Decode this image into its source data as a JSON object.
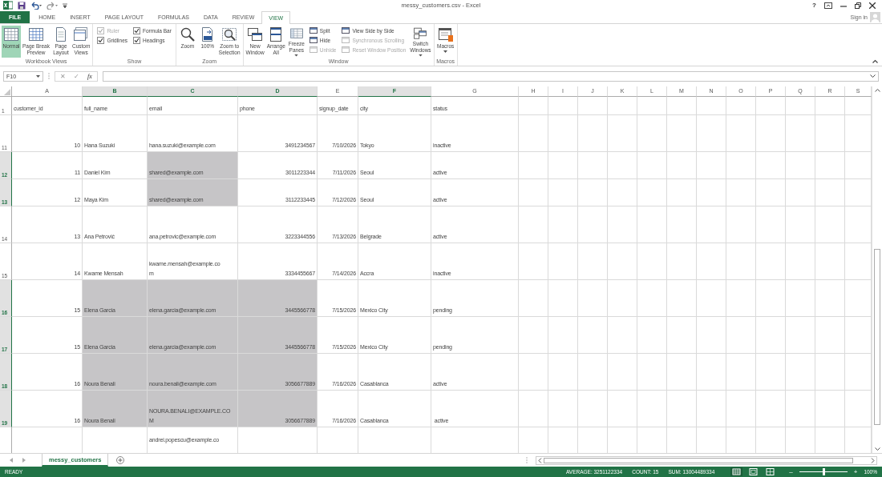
{
  "window": {
    "title": "messy_customers.csv - Excel",
    "help": "?",
    "sign_in": "Sign in"
  },
  "tabs": [
    {
      "label": "FILE",
      "kind": "file",
      "selected": false
    },
    {
      "label": "HOME",
      "kind": "tab",
      "selected": false
    },
    {
      "label": "INSERT",
      "kind": "tab",
      "selected": false
    },
    {
      "label": "PAGE LAYOUT",
      "kind": "tab",
      "selected": false
    },
    {
      "label": "FORMULAS",
      "kind": "tab",
      "selected": false
    },
    {
      "label": "DATA",
      "kind": "tab",
      "selected": false
    },
    {
      "label": "REVIEW",
      "kind": "tab",
      "selected": false
    },
    {
      "label": "VIEW",
      "kind": "tab",
      "selected": true
    }
  ],
  "ribbon": [
    {
      "label": "Workbook Views",
      "items": [
        {
          "kind": "large",
          "label": "Normal",
          "selected": true,
          "has_menu": false
        },
        {
          "kind": "large",
          "label": "Page Break\nPreview",
          "selected": false,
          "has_menu": false
        },
        {
          "kind": "large",
          "label": "Page\nLayout",
          "selected": false,
          "has_menu": false
        },
        {
          "kind": "large",
          "label": "Custom\nViews",
          "selected": false,
          "has_menu": false
        }
      ]
    },
    {
      "label": "Show",
      "items": [
        {
          "kind": "stack",
          "items": [
            {
              "kind": "checkbox",
              "label": "Ruler",
              "checked": true,
              "disabled": true
            },
            {
              "kind": "checkbox",
              "label": "Gridlines",
              "checked": true,
              "disabled": false
            }
          ]
        },
        {
          "kind": "stack",
          "items": [
            {
              "kind": "checkbox",
              "label": "Formula Bar",
              "checked": true,
              "disabled": false
            },
            {
              "kind": "checkbox",
              "label": "Headings",
              "checked": true,
              "disabled": false
            }
          ]
        }
      ]
    },
    {
      "label": "Zoom",
      "items": [
        {
          "kind": "large",
          "label": "Zoom",
          "selected": false,
          "has_menu": false
        },
        {
          "kind": "large",
          "label": "100%",
          "selected": false,
          "has_menu": false
        },
        {
          "kind": "large",
          "label": "Zoom to\nSelection",
          "selected": false,
          "has_menu": false
        }
      ]
    },
    {
      "label": "Window",
      "items": [
        {
          "kind": "large",
          "label": "New\nWindow",
          "selected": false,
          "has_menu": false
        },
        {
          "kind": "large",
          "label": "Arrange\nAll",
          "selected": false,
          "has_menu": false
        },
        {
          "kind": "large",
          "label": "Freeze\nPanes",
          "selected": false,
          "has_menu": true
        },
        {
          "kind": "stack",
          "items": [
            {
              "kind": "button",
              "label": "Split",
              "disabled": false
            },
            {
              "kind": "button",
              "label": "Hide",
              "disabled": false
            },
            {
              "kind": "button",
              "label": "Unhide",
              "disabled": true
            }
          ]
        },
        {
          "kind": "stack",
          "items": [
            {
              "kind": "button",
              "label": "View Side by Side",
              "disabled": false
            },
            {
              "kind": "button",
              "label": "Synchronous Scrolling",
              "disabled": true
            },
            {
              "kind": "button",
              "label": "Reset Window Position",
              "disabled": true
            }
          ]
        },
        {
          "kind": "large",
          "label": "Switch\nWindows",
          "selected": false,
          "has_menu": true
        }
      ]
    },
    {
      "label": "Macros",
      "items": [
        {
          "kind": "large",
          "label": "Macros",
          "selected": false,
          "has_menu": true
        }
      ]
    }
  ],
  "formula_bar": {
    "name_box": "F10",
    "cancel": "✕",
    "enter": "✓",
    "function_label": "fx"
  },
  "columns": [
    {
      "letter": "A",
      "selected": false
    },
    {
      "letter": "B",
      "selected": true
    },
    {
      "letter": "C",
      "selected": true
    },
    {
      "letter": "D",
      "selected": true
    },
    {
      "letter": "E",
      "selected": false
    },
    {
      "letter": "F",
      "selected": true
    },
    {
      "letter": "G",
      "selected": false
    },
    {
      "letter": "H",
      "selected": false
    },
    {
      "letter": "I",
      "selected": false
    },
    {
      "letter": "J",
      "selected": false
    },
    {
      "letter": "K",
      "selected": false
    },
    {
      "letter": "L",
      "selected": false
    },
    {
      "letter": "M",
      "selected": false
    },
    {
      "letter": "N",
      "selected": false
    },
    {
      "letter": "O",
      "selected": false
    },
    {
      "letter": "P",
      "selected": false
    },
    {
      "letter": "Q",
      "selected": false
    },
    {
      "letter": "R",
      "selected": false
    },
    {
      "letter": "S",
      "selected": false
    }
  ],
  "rows": [
    {
      "number": "1",
      "selected": false,
      "cells": [
        {
          "text": "customer_id",
          "kind": "text",
          "selected": false
        },
        {
          "text": "full_name",
          "kind": "text",
          "selected": false
        },
        {
          "text": "email",
          "kind": "text",
          "selected": false
        },
        {
          "text": "phone",
          "kind": "text",
          "selected": false
        },
        {
          "text": "signup_date",
          "kind": "text",
          "selected": false
        },
        {
          "text": "city",
          "kind": "text",
          "selected": false
        },
        {
          "text": "status",
          "kind": "text",
          "selected": false
        }
      ]
    },
    {
      "number": "11",
      "selected": false,
      "cells": [
        {
          "text": "10",
          "kind": "number",
          "selected": false
        },
        {
          "text": "Hana Suzuki",
          "kind": "text",
          "selected": false
        },
        {
          "text": "hana.suzuki@example.com",
          "kind": "text",
          "selected": false
        },
        {
          "text": "3491234567",
          "kind": "number",
          "selected": false
        },
        {
          "text": "7/10/2026",
          "kind": "number",
          "selected": false
        },
        {
          "text": "Tokyo",
          "kind": "text",
          "selected": false
        },
        {
          "text": "inactive",
          "kind": "text",
          "selected": false
        }
      ]
    },
    {
      "number": "12",
      "selected": true,
      "cells": [
        {
          "text": "11",
          "kind": "number",
          "selected": false
        },
        {
          "text": "Daniel Kim",
          "kind": "text",
          "selected": false
        },
        {
          "text": "shared@example.com",
          "kind": "text",
          "selected": true
        },
        {
          "text": "3011223344",
          "kind": "number",
          "selected": false
        },
        {
          "text": "7/11/2026",
          "kind": "number",
          "selected": false
        },
        {
          "text": "Seoul",
          "kind": "text",
          "selected": false
        },
        {
          "text": "active",
          "kind": "text",
          "selected": false
        }
      ]
    },
    {
      "number": "13",
      "selected": true,
      "cells": [
        {
          "text": "12",
          "kind": "number",
          "selected": false
        },
        {
          "text": "Maya Kim",
          "kind": "text",
          "selected": false
        },
        {
          "text": "shared@example.com",
          "kind": "text",
          "selected": true
        },
        {
          "text": "3112233445",
          "kind": "number",
          "selected": false
        },
        {
          "text": "7/12/2026",
          "kind": "number",
          "selected": false
        },
        {
          "text": "Seoul",
          "kind": "text",
          "selected": false
        },
        {
          "text": "active",
          "kind": "text",
          "selected": false
        }
      ]
    },
    {
      "number": "14",
      "selected": false,
      "cells": [
        {
          "text": "13",
          "kind": "number",
          "selected": false
        },
        {
          "text": "Ana Petrović",
          "kind": "text",
          "selected": false
        },
        {
          "text": "ana.petrovic@example.com",
          "kind": "text",
          "selected": false
        },
        {
          "text": "3223344556",
          "kind": "number",
          "selected": false
        },
        {
          "text": "7/13/2026",
          "kind": "number",
          "selected": false
        },
        {
          "text": "Belgrade",
          "kind": "text",
          "selected": false
        },
        {
          "text": "active",
          "kind": "text",
          "selected": false
        }
      ]
    },
    {
      "number": "15",
      "selected": false,
      "cells": [
        {
          "text": "14",
          "kind": "number",
          "selected": false
        },
        {
          "text": "Kwame Mensah",
          "kind": "text",
          "selected": false
        },
        {
          "text": "kwame.mensah@example.co\nm",
          "kind": "text",
          "selected": false
        },
        {
          "text": "3334455667",
          "kind": "number",
          "selected": false
        },
        {
          "text": "7/14/2026",
          "kind": "number",
          "selected": false
        },
        {
          "text": "Accra",
          "kind": "text",
          "selected": false
        },
        {
          "text": "inactive",
          "kind": "text",
          "selected": false
        }
      ]
    },
    {
      "number": "16",
      "selected": true,
      "cells": [
        {
          "text": "15",
          "kind": "number",
          "selected": false
        },
        {
          "text": "Elena Garcia",
          "kind": "text",
          "selected": true
        },
        {
          "text": "elena.garcia@example.com",
          "kind": "text",
          "selected": true
        },
        {
          "text": "3445566778",
          "kind": "number",
          "selected": true
        },
        {
          "text": "7/15/2026",
          "kind": "number",
          "selected": false
        },
        {
          "text": "Mexico City",
          "kind": "text",
          "selected": false
        },
        {
          "text": "pending",
          "kind": "text",
          "selected": false
        }
      ]
    },
    {
      "number": "17",
      "selected": true,
      "cells": [
        {
          "text": "15",
          "kind": "number",
          "selected": false
        },
        {
          "text": "Elena Garcia",
          "kind": "text",
          "selected": true
        },
        {
          "text": "elena.garcia@example.com",
          "kind": "text",
          "selected": true
        },
        {
          "text": "3445566778",
          "kind": "number",
          "selected": true
        },
        {
          "text": "7/15/2026",
          "kind": "number",
          "selected": false
        },
        {
          "text": "Mexico City",
          "kind": "text",
          "selected": false
        },
        {
          "text": "pending",
          "kind": "text",
          "selected": false
        }
      ]
    },
    {
      "number": "18",
      "selected": true,
      "cells": [
        {
          "text": "16",
          "kind": "number",
          "selected": false
        },
        {
          "text": "Noura Benali",
          "kind": "text",
          "selected": true
        },
        {
          "text": "noura.benali@example.com",
          "kind": "text",
          "selected": true
        },
        {
          "text": "3056677889",
          "kind": "number",
          "selected": true
        },
        {
          "text": "7/16/2026",
          "kind": "number",
          "selected": false
        },
        {
          "text": "Casablanca",
          "kind": "text",
          "selected": false
        },
        {
          "text": "active",
          "kind": "text",
          "selected": false
        }
      ]
    },
    {
      "number": "19",
      "selected": true,
      "cells": [
        {
          "text": "16",
          "kind": "number",
          "selected": false
        },
        {
          "text": "Noura Benali",
          "kind": "text",
          "selected": true
        },
        {
          "text": "NOURA.BENALI@EXAMPLE.CO\nM",
          "kind": "text",
          "selected": true
        },
        {
          "text": "3056677889",
          "kind": "number",
          "selected": true
        },
        {
          "text": "7/16/2026",
          "kind": "number",
          "selected": false
        },
        {
          "text": "Casablanca",
          "kind": "text",
          "selected": false
        },
        {
          "text": " active",
          "kind": "text",
          "selected": false
        }
      ]
    },
    {
      "selected": false,
      "cells": [
        {
          "kind": "text",
          "selected": false
        },
        {
          "kind": "text",
          "selected": false
        },
        {
          "text": "andrei.popescu@example.co",
          "kind": "cut",
          "selected": false
        }
      ]
    }
  ],
  "sheet_tabs": [
    {
      "label": "messy_customers",
      "selected": true
    }
  ],
  "status_bar": {
    "mode": "READY",
    "stats": [
      "AVERAGE: 3251122334",
      "COUNT: 15",
      "SUM: 13004489334"
    ],
    "view_buttons": [
      {
        "selected": true
      },
      {
        "selected": false
      },
      {
        "selected": false
      }
    ],
    "zoom_out": "–",
    "zoom_slider": {
      "level": 0.5
    },
    "zoom_in": "+",
    "zoom": "100%"
  }
}
